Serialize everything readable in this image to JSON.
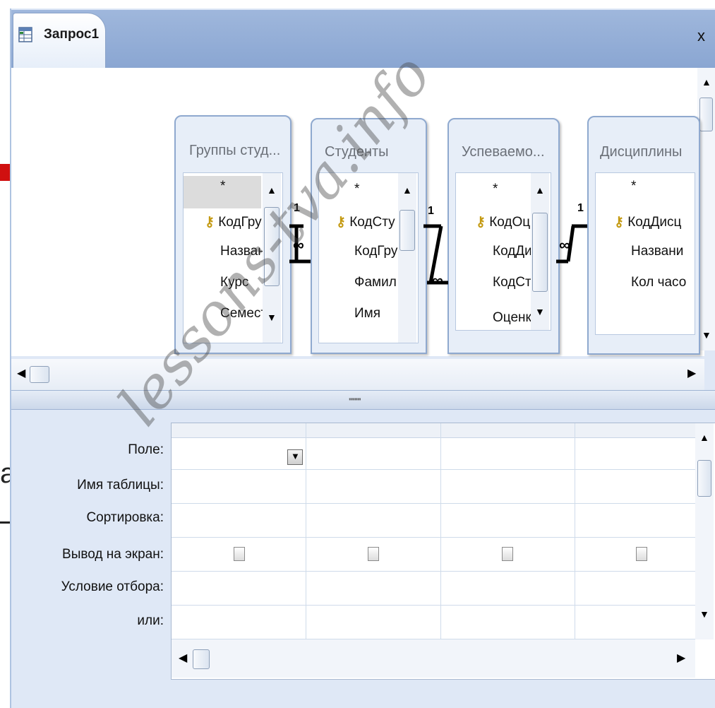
{
  "window": {
    "tab_title": "Запрос1",
    "close_label": "x"
  },
  "tables": [
    {
      "title": "Группы студ...",
      "fields": [
        "*",
        "КодГру",
        "Назван",
        "Курс",
        "Семест"
      ],
      "key_field_index": 1
    },
    {
      "title": "Студенты",
      "fields": [
        "*",
        "КодСту",
        "КодГру",
        "Фамил",
        "Имя"
      ],
      "key_field_index": 1
    },
    {
      "title": "Успеваемо...",
      "fields": [
        "*",
        "КодОц",
        "КодДи",
        "КодСт",
        "Оценк"
      ],
      "key_field_index": 1
    },
    {
      "title": "Дисциплины",
      "fields": [
        "*",
        "КодДисц",
        "Названи",
        "Кол часо"
      ],
      "key_field_index": 1
    }
  ],
  "relations": [
    {
      "from_label": "1",
      "to_label": "∞"
    },
    {
      "from_label": "1",
      "to_label": "∞"
    },
    {
      "from_label": "1",
      "to_label": "∞"
    }
  ],
  "grid": {
    "row_labels": [
      "Поле:",
      "Имя таблицы:",
      "Сортировка:",
      "Вывод на экран:",
      "Условие отбора:",
      "или:"
    ],
    "columns": 4
  },
  "watermark": "lessons-tva.info",
  "edge_text": "а",
  "icons": {
    "tab": "query-icon",
    "key": "key-icon",
    "dropdown": "chevron-down-icon"
  },
  "colors": {
    "frame": "#dfe8f6",
    "titlebar": "#8aa6d2",
    "accent_red": "#d01010"
  }
}
